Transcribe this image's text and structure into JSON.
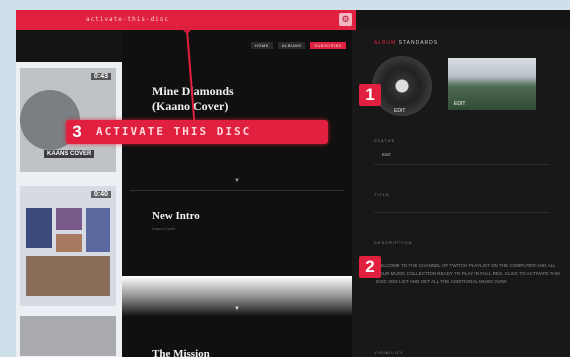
{
  "browser": {
    "url": "activate-this-disc",
    "gear_icon": "gear-icon"
  },
  "nav": {
    "items": [
      "HOME",
      "ALBUMS",
      "SUBSCRIBE"
    ]
  },
  "sidebar": {
    "videos": [
      {
        "duration": "0:43",
        "caption": "KAANS COVER"
      },
      {
        "duration": "0:40"
      },
      {
        "duration": ""
      }
    ]
  },
  "tracks": [
    {
      "title_line1": "Mine Diamonds",
      "title_line2": "(Kaano Cover)"
    },
    {
      "title": "New Intro",
      "subtitle": "Kaano Cover"
    },
    {
      "title": "The Mission"
    }
  ],
  "right": {
    "header_accent": "ALBUM",
    "header": "STANDARDS",
    "disc_label": "EDIT",
    "image_label": "EDIT",
    "sections": [
      {
        "label": "STATUS",
        "value": "EDIT"
      },
      {
        "label": "TITLE",
        "value": ""
      },
      {
        "label": "DESCRIPTION",
        "value": ""
      },
      {
        "label": "VISIBILITY",
        "value": ""
      }
    ],
    "description": "WELCOME TO THE CHANNEL OF TWITCH PLAYLIST ON THE COMPUTER AND ALL YOUR MUSIC COLLECTION READY TO PLAY IN FULL RES. CLICK TO ACTIVATE THIS DISC AND LIST AND GET ALL THE ADDITIONAL MUSIC NOW."
  },
  "annotations": [
    {
      "number": "1"
    },
    {
      "number": "2"
    },
    {
      "number": "3",
      "text": "ACTIVATE THIS DISC"
    }
  ],
  "colors": {
    "accent": "#e0203e",
    "background": "#141414",
    "page": "#cfe0ea"
  }
}
